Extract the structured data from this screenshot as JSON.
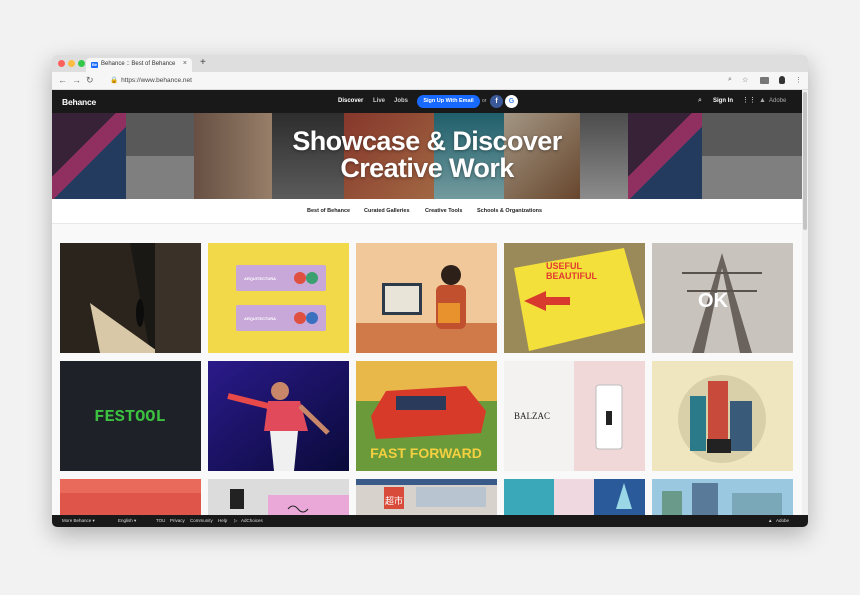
{
  "browser": {
    "tab_title": "Behance :: Best of Behance",
    "tab_favicon": "Bē",
    "new_tab": "+",
    "url": "https://www.behance.net"
  },
  "header": {
    "logo": "Behance",
    "nav": [
      "Discover",
      "Live",
      "Jobs"
    ],
    "signup": "Sign Up With Email",
    "or": "or",
    "facebook": "f",
    "google": "G",
    "signin": "Sign In",
    "adobe": "Adobe"
  },
  "hero": {
    "line1": "Showcase & Discover",
    "line2": "Creative Work"
  },
  "subnav": [
    "Best of Behance",
    "Curated Galleries",
    "Creative Tools",
    "Schools & Organizations"
  ],
  "cards": {
    "festool": "FESTOOL",
    "balzac": "BALZAC",
    "fastforward": "FAST FORWARD",
    "useful": "USEFUL",
    "beautiful": "BEAUTIFUL",
    "arqui": "ARQUITECTURA",
    "chao": "超市",
    "ok": "OK"
  },
  "footer": {
    "more": "More Behance",
    "lang": "English",
    "links": [
      "TOU",
      "Privacy",
      "Community",
      "Help",
      "AdChoices"
    ],
    "adobe": "Adobe"
  },
  "colors": {
    "accent": "#1769ff",
    "header_bg": "#191919"
  }
}
